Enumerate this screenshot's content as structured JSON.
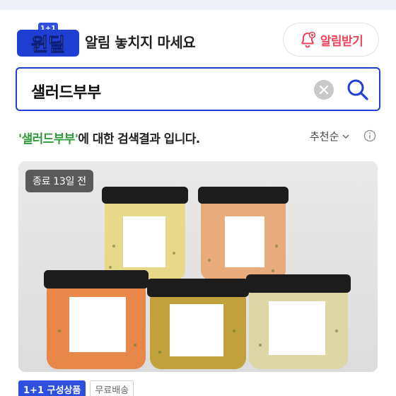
{
  "header": {
    "logo_text": "윈딜",
    "logo_badge": "1+1",
    "tagline": "알림 놓치지 마세요",
    "alarm_button_label": "알림받기"
  },
  "search": {
    "query": "샐러드부부"
  },
  "results": {
    "keyword": "'샐러드부부'",
    "suffix": "에 대한 검색결과 입니다.",
    "sort_label": "추천순"
  },
  "product": {
    "status_badge": "종료 13일 전",
    "tags": [
      "1+1 구성상품",
      "무료배송"
    ]
  },
  "colors": {
    "accent_blue": "#1f3fd6",
    "alarm_red": "#f0435a",
    "keyword_green": "#2f9b3a",
    "bundle_tag_blue": "#2f4fe0"
  },
  "icons": {
    "alarm": "bell-plus-icon",
    "clear": "close-circle-icon",
    "search": "search-icon",
    "sort": "chevron-down-icon",
    "info": "info-circle-icon"
  }
}
